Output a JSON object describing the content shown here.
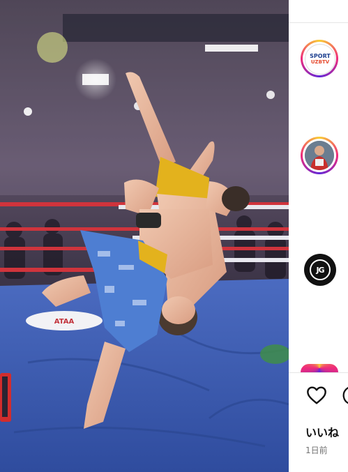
{
  "post": {
    "media_alt": "",
    "colors": {
      "mat": "#3e5fb8",
      "ropes_red": "#d0343c",
      "ropes_white": "#e8e8ee",
      "shorts_blue": "#4e7ed2",
      "shorts_yellow": "#e3b21d"
    }
  },
  "suggested_accounts": [
    {
      "name": "sport-uzbtv",
      "logo_top": "SPORT",
      "logo_bottom": "UZBTV",
      "has_story_ring": true
    },
    {
      "name": "fighter-photo",
      "has_story_ring": true
    },
    {
      "name": "jg-logo",
      "logo_text": "JG",
      "has_story_ring": false
    },
    {
      "name": "partial-avatar",
      "has_story_ring": true
    }
  ],
  "actions": {
    "like_icon": "heart-icon",
    "comment_icon": "comment-icon"
  },
  "likes_label": "いいね",
  "time_ago": "1日前"
}
